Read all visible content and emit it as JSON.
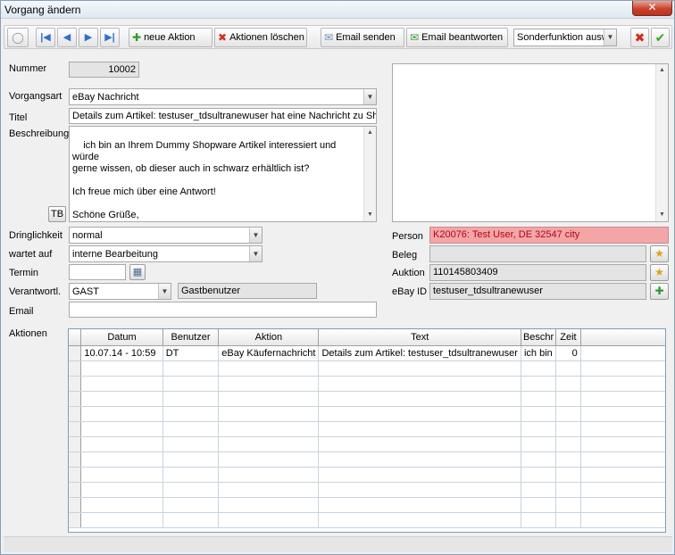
{
  "window": {
    "title": "Vorgang ändern",
    "close_label": "✕"
  },
  "toolbar": {
    "neue_aktion": "neue Aktion",
    "aktionen_loeschen": "Aktionen löschen",
    "email_senden": "Email senden",
    "email_beantworten": "Email beantworten",
    "sonderfunktion": "Sonderfunktion ausw"
  },
  "form": {
    "nummer_label": "Nummer",
    "nummer_value": "10002",
    "vorgangsart_label": "Vorgangsart",
    "vorgangsart_value": "eBay Nachricht",
    "titel_label": "Titel",
    "titel_value": "Details zum Artikel: testuser_tdsultranewuser hat eine Nachricht zu Shop",
    "beschreibung_label": "Beschreibung",
    "beschreibung_value": "ich bin an Ihrem Dummy Shopware Artikel interessiert und würde\ngerne wissen, ob dieser auch in schwarz erhältlich ist?\n\nIch freue mich über eine Antwort!\n\nSchöne Grüße,\nultranewuser",
    "tb_label": "TB",
    "dringlichkeit_label": "Dringlichkeit",
    "dringlichkeit_value": "normal",
    "wartet_label": "wartet auf",
    "wartet_value": "interne Bearbeitung",
    "termin_label": "Termin",
    "termin_value": "",
    "verantwortl_label": "Verantwortl.",
    "verantwortl_value": "GAST",
    "verantwortl_name": "Gastbenutzer",
    "email_label": "Email",
    "email_value": "",
    "aktionen_label": "Aktionen"
  },
  "right": {
    "person_label": "Person",
    "person_value": "K20076: Test User, DE 32547 city",
    "beleg_label": "Beleg",
    "beleg_value": "",
    "auktion_label": "Auktion",
    "auktion_value": "110145803409",
    "ebayid_label": "eBay ID",
    "ebayid_value": "testuser_tdsultranewuser"
  },
  "grid": {
    "columns": [
      "Datum",
      "Benutzer",
      "Aktion",
      "Text",
      "Beschr",
      "Zeit"
    ],
    "rows": [
      [
        "10.07.14 - 10:59",
        "DT",
        "eBay Käufernachricht",
        "Details zum Artikel: testuser_tdsultranewuser",
        "ich bin",
        "0"
      ]
    ]
  },
  "colors": {
    "accent": "#2f6fd1",
    "person_bg": "#f4a6a6",
    "person_text": "#b3001b",
    "close": "#c9432c"
  }
}
